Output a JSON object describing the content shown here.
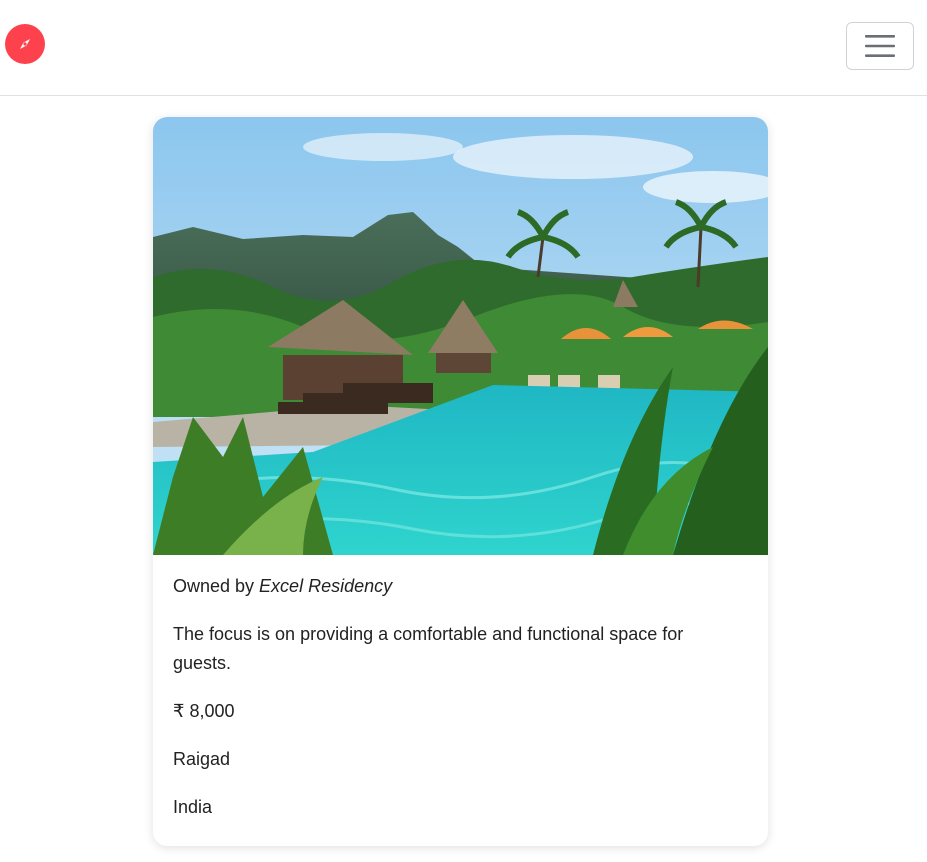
{
  "navbar": {
    "brand_icon": "compass-icon",
    "brand_color": "#fe424d",
    "toggler_icon": "hamburger-menu-icon"
  },
  "listing": {
    "image_alt": "Resort pool surrounded by palm trees and thatched villas with mountains",
    "owner_prefix": "Owned by ",
    "owner_name": "Excel Residency",
    "description": "The focus is on providing a comfortable and functional space for guests.",
    "price": "₹ 8,000",
    "location": "Raigad",
    "country": "India"
  }
}
